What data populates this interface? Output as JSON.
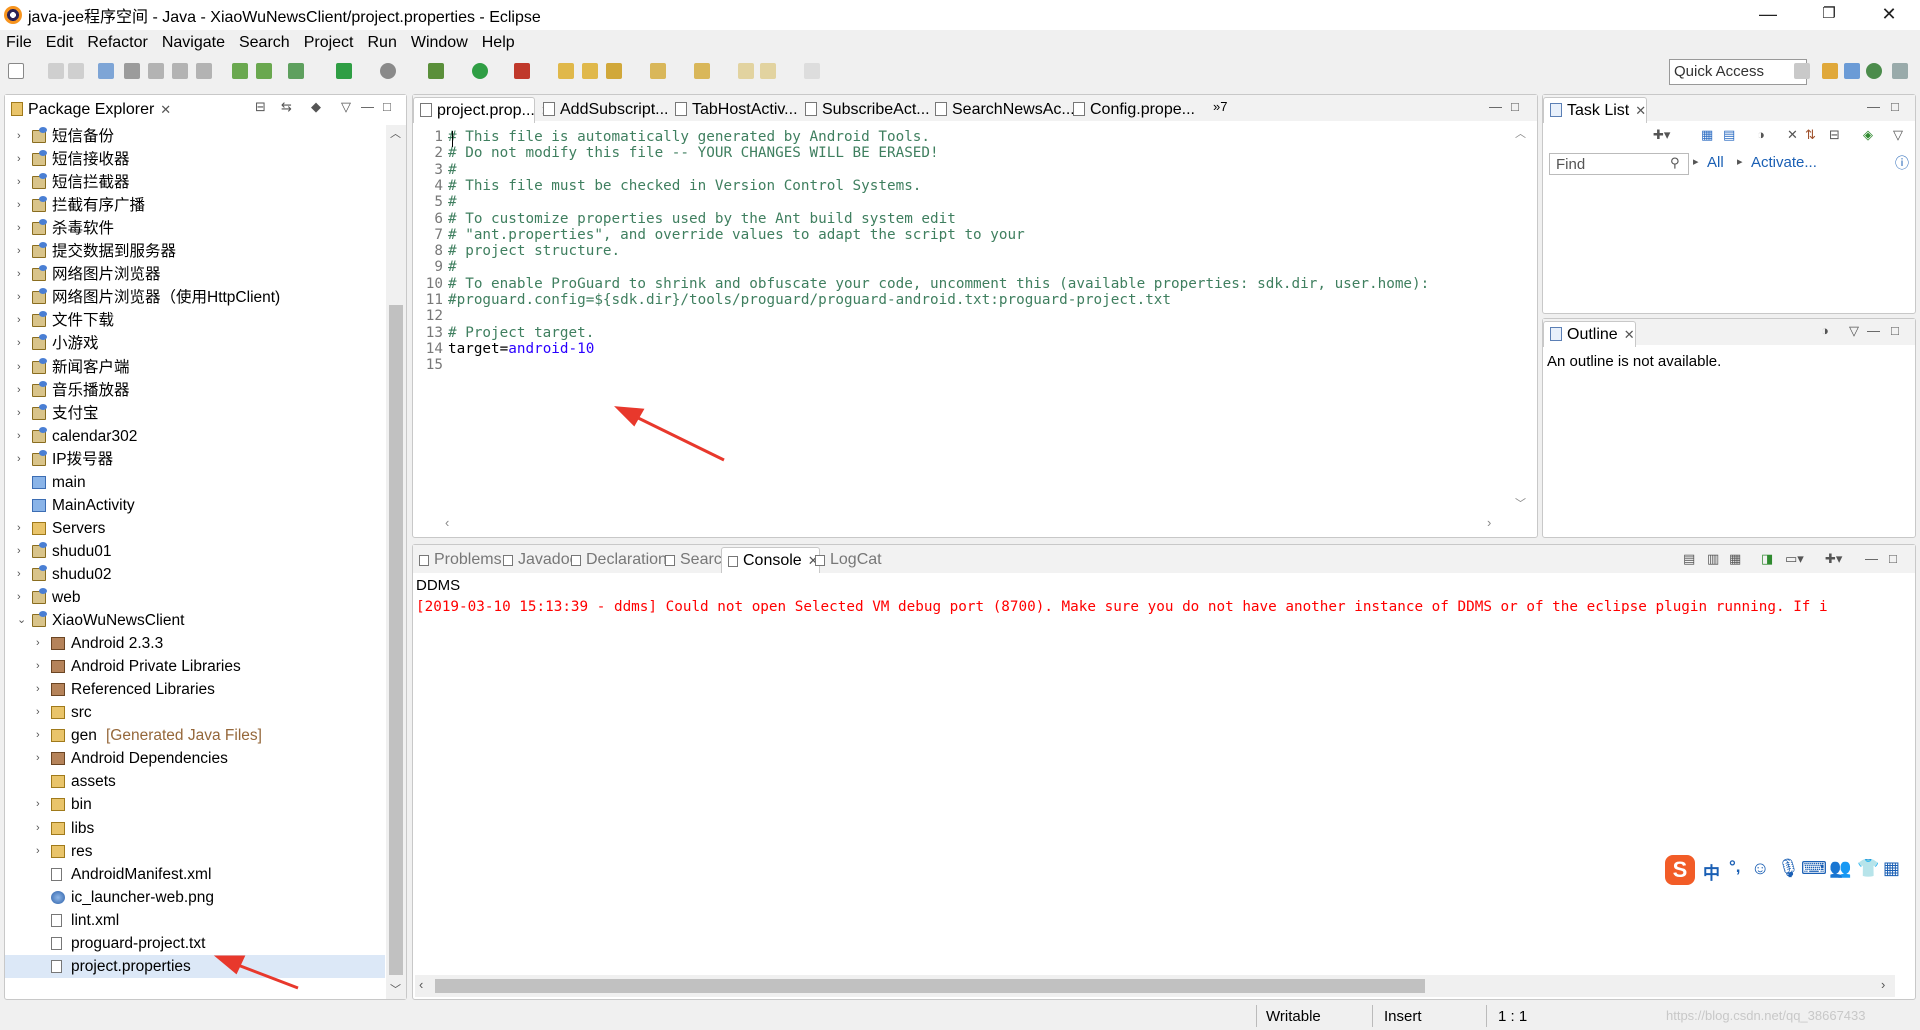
{
  "window": {
    "title": "java-jee程序空间 - Java - XiaoWuNewsClient/project.properties - Eclipse",
    "minimize": "—",
    "maximize": "❐",
    "close": "✕"
  },
  "menu": [
    "File",
    "Edit",
    "Refactor",
    "Navigate",
    "Search",
    "Project",
    "Run",
    "Window",
    "Help"
  ],
  "toolbar": {
    "quick_access": "Quick Access"
  },
  "package_explorer": {
    "title": "Package Explorer",
    "items": [
      {
        "label": "短信备份",
        "icon": "project-icon",
        "indent": 0,
        "expand": "›"
      },
      {
        "label": "短信接收器",
        "icon": "project-icon",
        "indent": 0,
        "expand": "›"
      },
      {
        "label": "短信拦截器",
        "icon": "project-icon",
        "indent": 0,
        "expand": "›"
      },
      {
        "label": "拦截有序广播",
        "icon": "project-icon",
        "indent": 0,
        "expand": "›"
      },
      {
        "label": "杀毒软件",
        "icon": "project-icon",
        "indent": 0,
        "expand": "›"
      },
      {
        "label": "提交数据到服务器",
        "icon": "project-icon",
        "indent": 0,
        "expand": "›"
      },
      {
        "label": "网络图片浏览器",
        "icon": "project-icon",
        "indent": 0,
        "expand": "›"
      },
      {
        "label": "网络图片浏览器（使用HttpClient)",
        "icon": "project-icon",
        "indent": 0,
        "expand": "›"
      },
      {
        "label": "文件下载",
        "icon": "project-icon",
        "indent": 0,
        "expand": "›"
      },
      {
        "label": "小游戏",
        "icon": "project-icon",
        "indent": 0,
        "expand": "›"
      },
      {
        "label": "新闻客户端",
        "icon": "project-icon",
        "indent": 0,
        "expand": "›"
      },
      {
        "label": "音乐播放器",
        "icon": "project-icon",
        "indent": 0,
        "expand": "›"
      },
      {
        "label": "支付宝",
        "icon": "project-icon",
        "indent": 0,
        "expand": "›"
      },
      {
        "label": "calendar302",
        "icon": "project-icon",
        "indent": 0,
        "expand": "›"
      },
      {
        "label": "IP拨号器",
        "icon": "project-icon",
        "indent": 0,
        "expand": "›"
      },
      {
        "label": "main",
        "icon": "closed-project-icon",
        "indent": 0,
        "expand": ""
      },
      {
        "label": "MainActivity",
        "icon": "closed-project-icon",
        "indent": 0,
        "expand": ""
      },
      {
        "label": "Servers",
        "icon": "folder-icon",
        "indent": 0,
        "expand": "›"
      },
      {
        "label": "shudu01",
        "icon": "project-icon",
        "indent": 0,
        "expand": "›"
      },
      {
        "label": "shudu02",
        "icon": "project-icon",
        "indent": 0,
        "expand": "›"
      },
      {
        "label": "web",
        "icon": "project-icon",
        "indent": 0,
        "expand": "›"
      },
      {
        "label": "XiaoWuNewsClient",
        "icon": "project-icon",
        "indent": 0,
        "expand": "⌄"
      },
      {
        "label": "Android 2.3.3",
        "icon": "library-icon",
        "indent": 1,
        "expand": "›"
      },
      {
        "label": "Android Private Libraries",
        "icon": "library-icon",
        "indent": 1,
        "expand": "›"
      },
      {
        "label": "Referenced Libraries",
        "icon": "library-icon",
        "indent": 1,
        "expand": "›"
      },
      {
        "label": "src",
        "icon": "package-folder-icon",
        "indent": 1,
        "expand": "›"
      },
      {
        "label": "gen",
        "suffix": "[Generated Java Files]",
        "icon": "package-folder-icon",
        "indent": 1,
        "expand": "›"
      },
      {
        "label": "Android Dependencies",
        "icon": "library-icon",
        "indent": 1,
        "expand": "›"
      },
      {
        "label": "assets",
        "icon": "folder-icon",
        "indent": 1,
        "expand": ""
      },
      {
        "label": "bin",
        "icon": "folder-icon",
        "indent": 1,
        "expand": "›"
      },
      {
        "label": "libs",
        "icon": "folder-icon",
        "indent": 1,
        "expand": "›"
      },
      {
        "label": "res",
        "icon": "folder-icon",
        "indent": 1,
        "expand": "›"
      },
      {
        "label": "AndroidManifest.xml",
        "icon": "xml-file-icon",
        "indent": 1,
        "expand": ""
      },
      {
        "label": "ic_launcher-web.png",
        "icon": "image-file-icon",
        "indent": 1,
        "expand": ""
      },
      {
        "label": "lint.xml",
        "icon": "xml-file-icon",
        "indent": 1,
        "expand": ""
      },
      {
        "label": "proguard-project.txt",
        "icon": "text-file-icon",
        "indent": 1,
        "expand": ""
      },
      {
        "label": "project.properties",
        "icon": "properties-file-icon",
        "indent": 1,
        "expand": "",
        "selected": true
      }
    ]
  },
  "editor": {
    "tabs": [
      "project.prop...",
      "AddSubscript...",
      "TabHostActiv...",
      "SubscribeAct...",
      "SearchNewsAc...",
      "Config.prope..."
    ],
    "overflow": "»7",
    "lines": [
      {
        "n": "1",
        "text": "# This file is automatically generated by Android Tools.",
        "kind": "comment"
      },
      {
        "n": "2",
        "text": "# Do not modify this file -- YOUR CHANGES WILL BE ERASED!",
        "kind": "comment"
      },
      {
        "n": "3",
        "text": "#",
        "kind": "comment"
      },
      {
        "n": "4",
        "text": "# This file must be checked in Version Control Systems.",
        "kind": "comment"
      },
      {
        "n": "5",
        "text": "#",
        "kind": "comment"
      },
      {
        "n": "6",
        "text": "# To customize properties used by the Ant build system edit",
        "kind": "comment"
      },
      {
        "n": "7",
        "text": "# \"ant.properties\", and override values to adapt the script to your",
        "kind": "comment"
      },
      {
        "n": "8",
        "text": "# project structure.",
        "kind": "comment"
      },
      {
        "n": "9",
        "text": "#",
        "kind": "comment"
      },
      {
        "n": "10",
        "text": "# To enable ProGuard to shrink and obfuscate your code, uncomment this (available properties: sdk.dir, user.home):",
        "kind": "comment"
      },
      {
        "n": "11",
        "text": "#proguard.config=${sdk.dir}/tools/proguard/proguard-android.txt:proguard-project.txt",
        "kind": "comment"
      },
      {
        "n": "12",
        "text": "",
        "kind": "plain"
      },
      {
        "n": "13",
        "text": "# Project target.",
        "kind": "comment"
      },
      {
        "n": "14",
        "key": "target=",
        "value": "android-10",
        "kind": "property"
      },
      {
        "n": "15",
        "text": "",
        "kind": "plain"
      }
    ]
  },
  "task_list": {
    "title": "Task List",
    "find_placeholder": "Find",
    "all": "All",
    "activate": "Activate..."
  },
  "outline": {
    "title": "Outline",
    "message": "An outline is not available."
  },
  "bottom_tabs": [
    "Problems",
    "Javadoc",
    "Declaration",
    "Search",
    "Console",
    "LogCat"
  ],
  "console": {
    "name": "DDMS",
    "message": "[2019-03-10 15:13:39 - ddms] Could not open Selected VM debug port (8700). Make sure you do not have another instance of DDMS or of the eclipse plugin running. If i"
  },
  "ime": {
    "label": "中",
    "punct": "°,"
  },
  "status": {
    "writable": "Writable",
    "insert": "Insert",
    "position": "1 : 1",
    "watermark": "https://blog.csdn.net/qq_38667433"
  },
  "colors": {
    "comment": "#3f7f5f",
    "value": "#2a00ff",
    "console_error": "#ff0000",
    "arrow": "#e8382c"
  }
}
